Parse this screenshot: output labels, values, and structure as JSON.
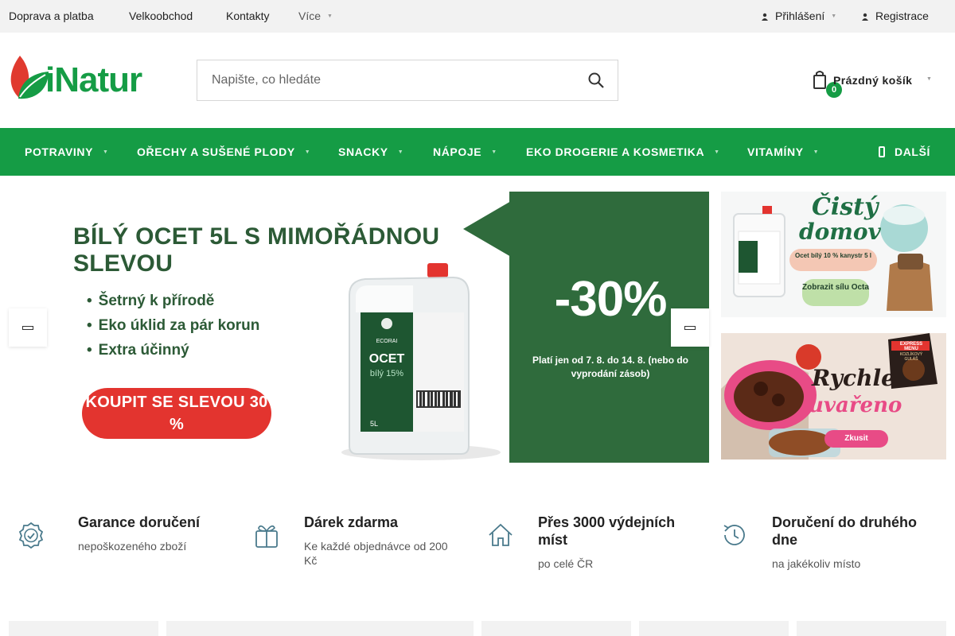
{
  "topbar": {
    "links": [
      "Doprava a platba",
      "Velkoobchod",
      "Kontakty"
    ],
    "more": "Více",
    "login": "Přihlášení",
    "register": "Registrace"
  },
  "logo": {
    "text": "iNatur"
  },
  "search": {
    "placeholder": "Napište, co hledáte"
  },
  "cart": {
    "count": "0",
    "label": "Prázdný košík"
  },
  "nav": {
    "items": [
      "POTRAVINY",
      "OŘECHY A SUŠENÉ PLODY",
      "SNACKY",
      "NÁPOJE",
      "EKO DROGERIE A KOSMETIKA",
      "VITAMÍNY"
    ],
    "more": "DALŠÍ"
  },
  "hero": {
    "headline": "BÍLÝ OCET 5L S MIMOŘÁDNOU SLEVOU",
    "bullets": [
      "Šetrný k přírodě",
      "Eko úklid za pár korun",
      "Extra účinný"
    ],
    "cta": "KOUPIT SE SLEVOU 30 %",
    "discount": "-30%",
    "validity": "Platí jen od 7. 8. do 14. 8. (nebo do vyprodání zásob)",
    "product_brand": "ECORAI",
    "product_name": "OCET",
    "product_sub": "bílý 15%",
    "product_size": "5L"
  },
  "side_banner_1": {
    "title_line1": "Čistý",
    "title_line2": "domov",
    "tag": "Ocet bílý 10 % kanystr 5 l",
    "button": "Zobrazit sílu Octa"
  },
  "side_banner_2": {
    "title_line1": "Rychle",
    "title_line2": "uvařeno",
    "button": "Zkusit",
    "pack_label": "EXPRESS MENU",
    "pack_name": "KOZLÍKOVÝ GULÁŠ"
  },
  "benefits": [
    {
      "title": "Garance doručení",
      "subtitle": "nepoškozeného zboží",
      "icon": "badge-check-icon"
    },
    {
      "title": "Dárek zdarma",
      "subtitle": "Ke každé objednávce od 200 Kč",
      "icon": "gift-icon"
    },
    {
      "title": "Přes 3000 výdejních míst",
      "subtitle": "po celé ČR",
      "icon": "home-icon"
    },
    {
      "title": "Doručení do druhého dne",
      "subtitle": "na jakékoliv místo",
      "icon": "history-icon"
    }
  ],
  "colors": {
    "brand_green": "#159c45",
    "hero_green": "#2f6b3c",
    "cta_red": "#e3342f",
    "topbar_bg": "#f2f2f2"
  }
}
